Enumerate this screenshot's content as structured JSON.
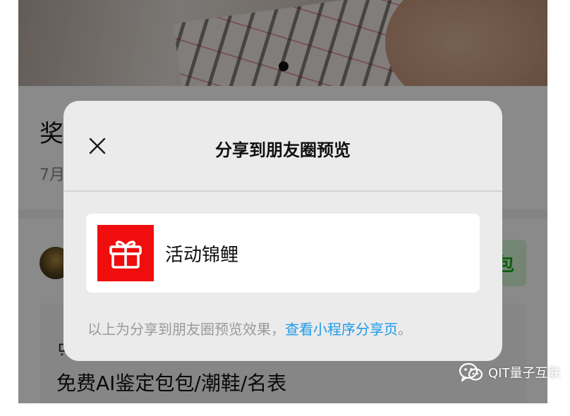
{
  "background_article": {
    "title_partial": "奖",
    "date_partial": "7月",
    "button_partial": "包",
    "card_line1_partial": "只",
    "card_line2": "免费AI鉴定包包/潮鞋/名表"
  },
  "dialog": {
    "title": "分享到朋友圈预览",
    "close_icon": "close-icon",
    "share_card": {
      "icon": "gift-icon",
      "icon_bg_color": "#ef0d0d",
      "name": "活动锦鲤"
    },
    "footer": {
      "note": "以上为分享到朋友圈预览效果，",
      "link": "查看小程序分享页",
      "end": "。",
      "link_color": "#1e9be8"
    }
  },
  "watermark": {
    "icon": "wechat-icon",
    "text": "QIT量子互联"
  }
}
